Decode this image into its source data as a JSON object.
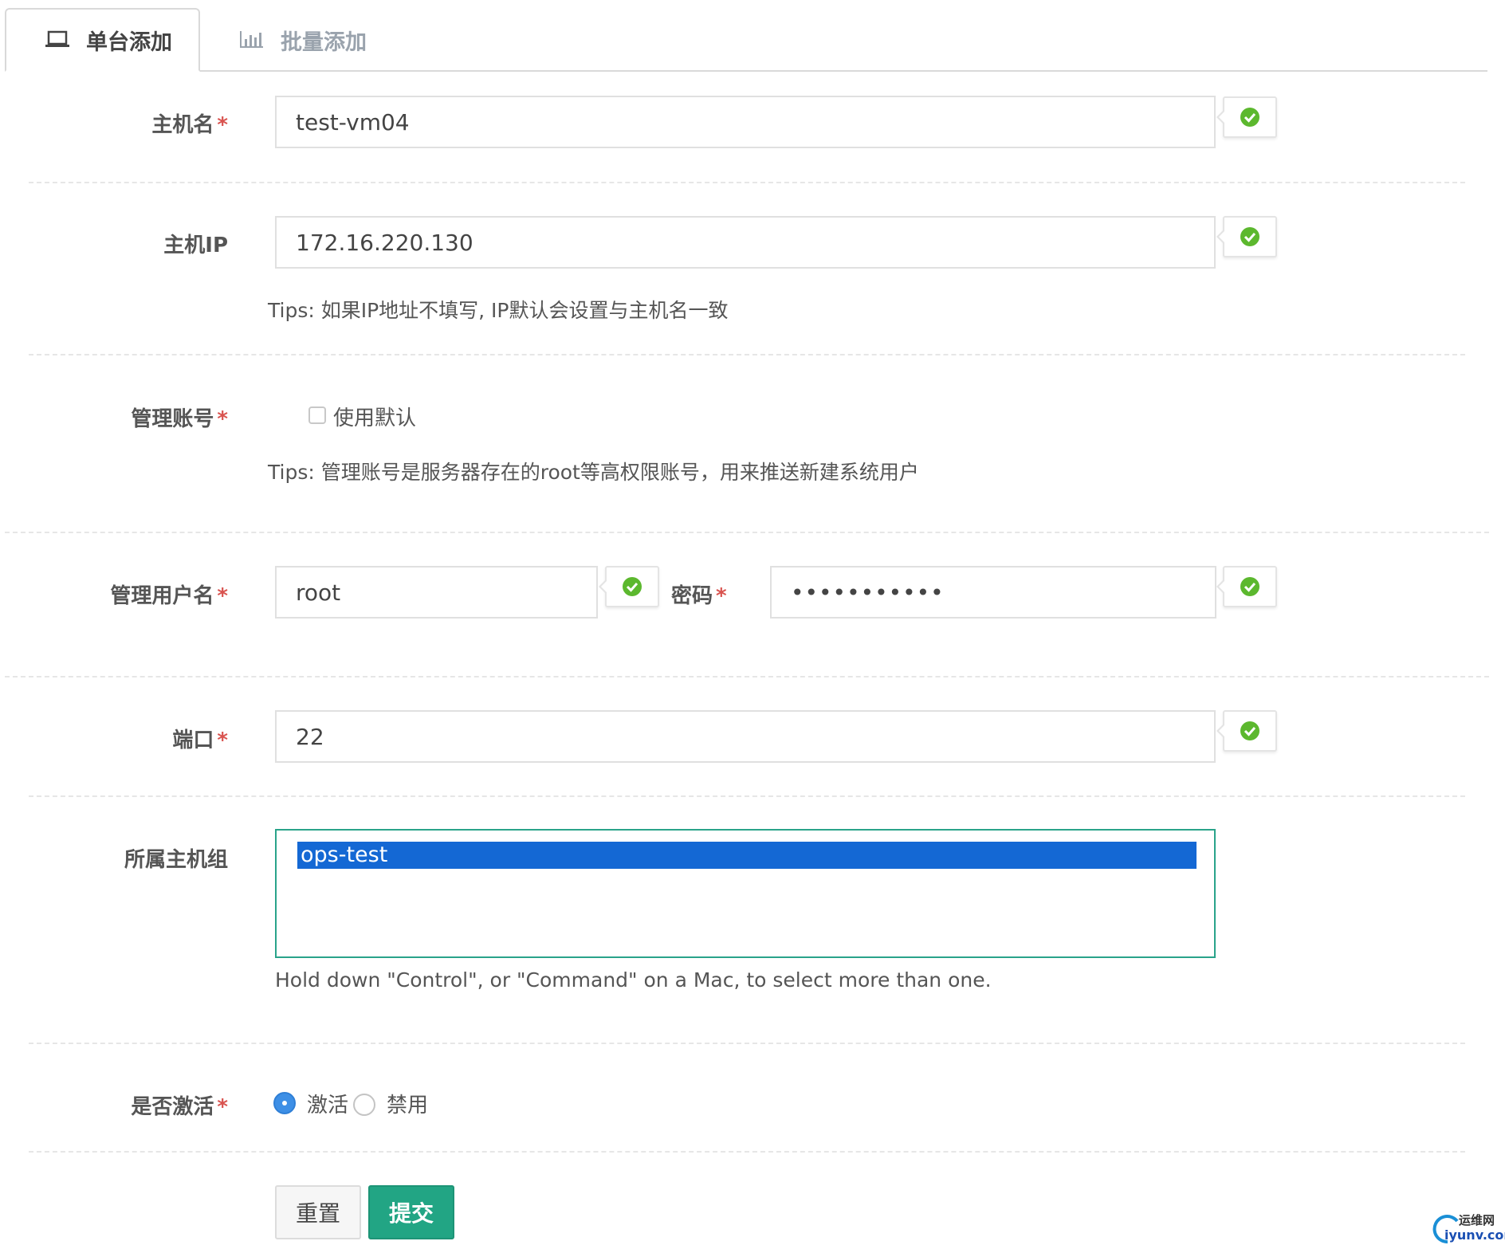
{
  "tabs": [
    {
      "label": "单台添加",
      "icon": "laptop-icon",
      "active": true
    },
    {
      "label": "批量添加",
      "icon": "bar-chart-icon",
      "active": false
    }
  ],
  "form": {
    "hostname": {
      "label": "主机名",
      "required_mark": "*",
      "value": "test-vm04",
      "valid": true
    },
    "host_ip": {
      "label": "主机IP",
      "value": "172.16.220.130",
      "valid": true,
      "tip": "Tips: 如果IP地址不填写, IP默认会设置与主机名一致"
    },
    "admin_account": {
      "label": "管理账号",
      "required_mark": "*",
      "checkbox_label": "使用默认",
      "checked": false,
      "tip": "Tips: 管理账号是服务器存在的root等高权限账号，用来推送新建系统用户"
    },
    "admin_username": {
      "label": "管理用户名",
      "required_mark": "*",
      "value": "root",
      "valid": true
    },
    "password": {
      "label": "密码",
      "required_mark": "*",
      "value": "•••••••••••",
      "valid": true
    },
    "port": {
      "label": "端口",
      "required_mark": "*",
      "value": "22",
      "valid": true
    },
    "host_group": {
      "label": "所属主机组",
      "options": [
        "ops-test"
      ],
      "selected": "ops-test",
      "help": "Hold down \"Control\", or \"Command\" on a Mac, to select more than one."
    },
    "active": {
      "label": "是否激活",
      "required_mark": "*",
      "options": [
        {
          "label": "激活",
          "selected": true
        },
        {
          "label": "禁用",
          "selected": false
        }
      ]
    }
  },
  "buttons": {
    "reset": "重置",
    "submit": "提交"
  },
  "watermark": {
    "cn": "运维网",
    "en": "iyunv.com"
  },
  "colors": {
    "accent": "#22a584",
    "required": "#d9534f",
    "selection": "#1468d4",
    "valid": "#5cb82e"
  }
}
